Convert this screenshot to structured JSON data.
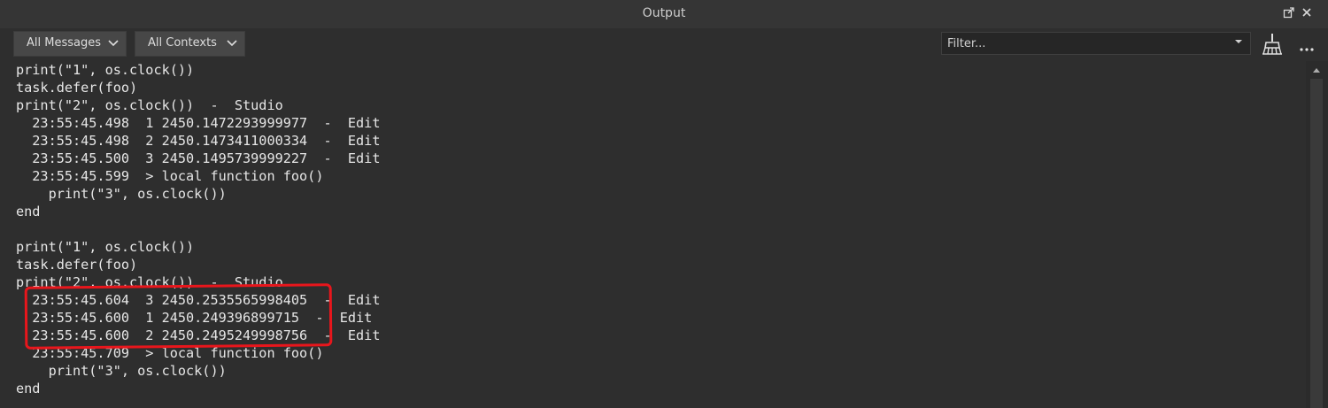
{
  "window": {
    "title": "Output"
  },
  "toolbar": {
    "messages_filter": "All Messages",
    "contexts_filter": "All Contexts",
    "filter_placeholder": "Filter..."
  },
  "console": {
    "lines": [
      "print(\"1\", os.clock())",
      "task.defer(foo)",
      "print(\"2\", os.clock())  -  Studio",
      "  23:55:45.498  1 2450.1472293999977  -  Edit",
      "  23:55:45.498  2 2450.1473411000334  -  Edit",
      "  23:55:45.500  3 2450.1495739999227  -  Edit",
      "  23:55:45.599  > local function foo()",
      "    print(\"3\", os.clock())",
      "end",
      "",
      "print(\"1\", os.clock())",
      "task.defer(foo)",
      "print(\"2\", os.clock())  -  Studio",
      "  23:55:45.604  3 2450.2535565998405  -  Edit",
      "  23:55:45.600  1 2450.249396899715  -  Edit",
      "  23:55:45.600  2 2450.2495249998756  -  Edit",
      "  23:55:45.709  > local function foo()",
      "    print(\"3\", os.clock())",
      "end"
    ]
  },
  "colors": {
    "background": "#2e2e2e",
    "text": "#e6e6e6",
    "highlight": "#e8161c"
  }
}
